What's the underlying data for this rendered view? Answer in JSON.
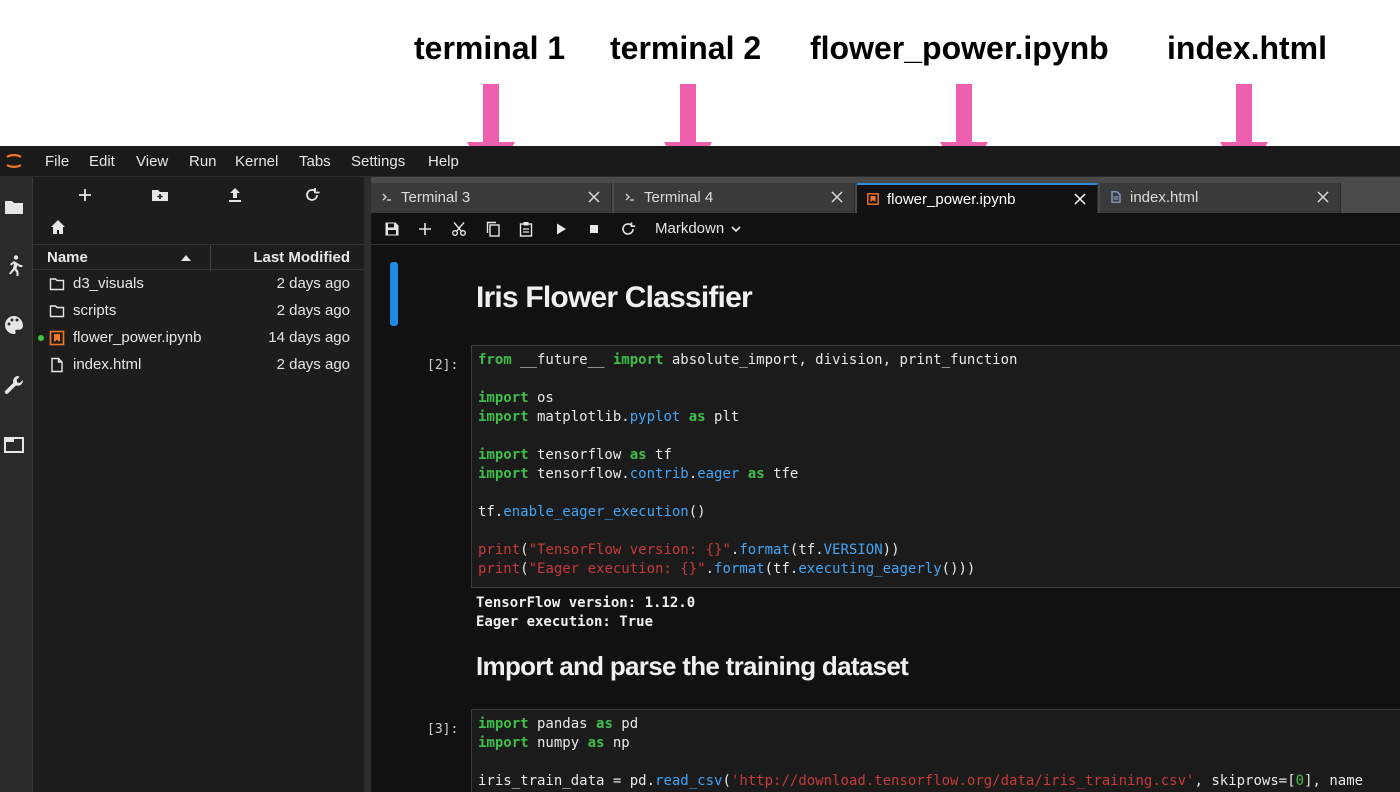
{
  "annotations": [
    {
      "label": "terminal 1"
    },
    {
      "label": "terminal 2"
    },
    {
      "label": "flower_power.ipynb"
    },
    {
      "label": "index.html"
    }
  ],
  "colors": {
    "arrow": "#ee5fb0",
    "accent": "#2d8be3",
    "keyword": "#3fbf49",
    "function": "#42a5f5",
    "string": "#c73a3a"
  },
  "menubar": {
    "items": [
      "File",
      "Edit",
      "View",
      "Run",
      "Kernel",
      "Tabs",
      "Settings",
      "Help"
    ]
  },
  "sidebar": {
    "icons": [
      "folder-icon",
      "running-icon",
      "palette-icon",
      "wrench-icon",
      "tabs-icon"
    ]
  },
  "filebrowser": {
    "toolbar_icons": [
      "plus-icon",
      "new-folder-icon",
      "upload-icon",
      "refresh-icon"
    ],
    "columns": {
      "name": "Name",
      "modified": "Last Modified"
    },
    "items": [
      {
        "name": "d3_visuals",
        "modified": "2 days ago",
        "type": "folder"
      },
      {
        "name": "scripts",
        "modified": "2 days ago",
        "type": "folder"
      },
      {
        "name": "flower_power.ipynb",
        "modified": "14 days ago",
        "type": "notebook",
        "running": true
      },
      {
        "name": "index.html",
        "modified": "2 days ago",
        "type": "file"
      }
    ]
  },
  "tabs": [
    {
      "label": "Terminal 3",
      "icon": "terminal-icon",
      "active": false
    },
    {
      "label": "Terminal 4",
      "icon": "terminal-icon",
      "active": false
    },
    {
      "label": "flower_power.ipynb",
      "icon": "notebook-icon",
      "active": true
    },
    {
      "label": "index.html",
      "icon": "file-icon",
      "active": false
    }
  ],
  "notebook_toolbar": {
    "icons": [
      "save-icon",
      "add-cell-icon",
      "cut-icon",
      "copy-icon",
      "paste-icon",
      "run-icon",
      "stop-icon",
      "restart-icon"
    ],
    "cell_type": "Markdown"
  },
  "notebook": {
    "heading1": "Iris Flower Classifier",
    "cell2_prompt": "[2]:",
    "cell2_output": [
      "TensorFlow version: 1.12.0",
      "Eager execution: True"
    ],
    "heading2": "Import and parse the training dataset",
    "cell3_prompt": "[3]:"
  }
}
